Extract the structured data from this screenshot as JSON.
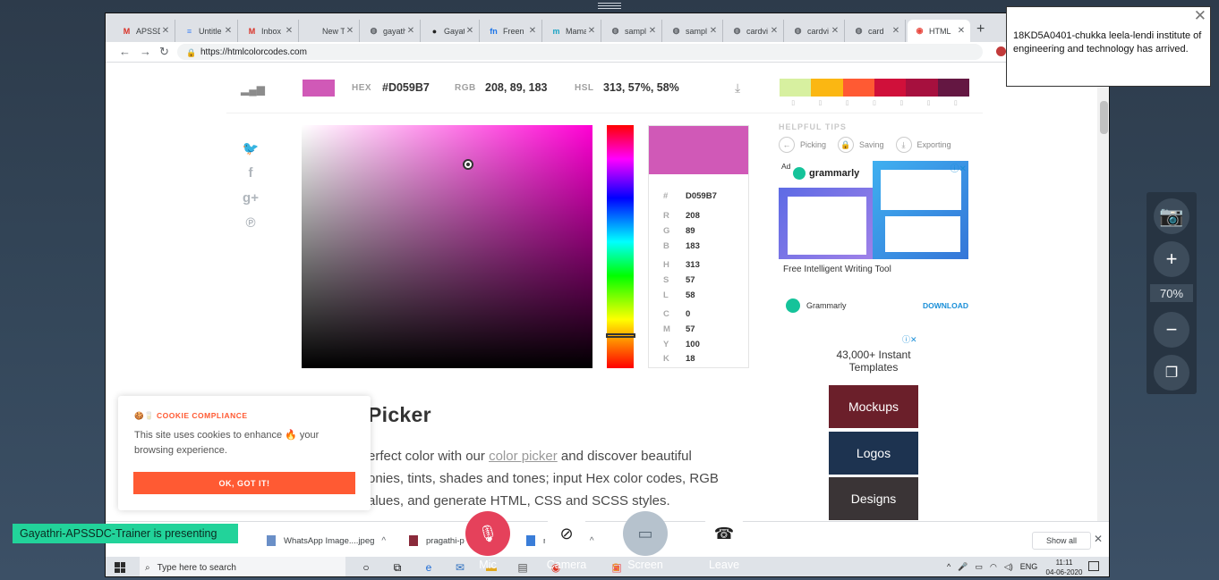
{
  "browser": {
    "tabs": [
      {
        "title": "APSSD",
        "icon": "gmail-icon",
        "color": "#d93025",
        "glyph": "M"
      },
      {
        "title": "Untitle",
        "icon": "docs-icon",
        "color": "#4285f4",
        "glyph": "≡"
      },
      {
        "title": "Inbox",
        "icon": "gmail-icon",
        "color": "#d93025",
        "glyph": "M"
      },
      {
        "title": "New Tab",
        "icon": "none",
        "color": "#5f6368",
        "glyph": ""
      },
      {
        "title": "gayath",
        "icon": "globe-icon",
        "color": "#5f6368",
        "glyph": "◍"
      },
      {
        "title": "Gayath",
        "icon": "github-icon",
        "color": "#222222",
        "glyph": "●"
      },
      {
        "title": "Freen",
        "icon": "freenom-icon",
        "color": "#1a73e8",
        "glyph": "fn"
      },
      {
        "title": "Mama",
        "icon": "mamp-icon",
        "color": "#1aa3c4",
        "glyph": "m"
      },
      {
        "title": "sampl",
        "icon": "globe-icon",
        "color": "#5f6368",
        "glyph": "◍"
      },
      {
        "title": "sampl",
        "icon": "globe-icon",
        "color": "#5f6368",
        "glyph": "◍"
      },
      {
        "title": "cardvi",
        "icon": "globe-icon",
        "color": "#5f6368",
        "glyph": "◍"
      },
      {
        "title": "cardvi",
        "icon": "globe-icon",
        "color": "#5f6368",
        "glyph": "◍"
      },
      {
        "title": "card",
        "icon": "globe-icon",
        "color": "#5f6368",
        "glyph": "◍"
      },
      {
        "title": "HTML",
        "icon": "htmlcolorcodes-icon",
        "color": "#e8453c",
        "glyph": "◉",
        "active": true
      }
    ],
    "new_tab_label": "+",
    "url": "https://htmlcolorcodes.com"
  },
  "color_bar": {
    "hex_label": "HEX",
    "hex_value": "#D059B7",
    "rgb_label": "RGB",
    "rgb_value": "208, 89, 183",
    "hsl_label": "HSL",
    "hsl_value": "313, 57%, 58%",
    "swatch_color": "#d059b7",
    "palette": [
      "#d7f0a0",
      "#fbb712",
      "#ff5a33",
      "#d0103a",
      "#a6103e",
      "#641742"
    ],
    "palette_marks": [
      "▯",
      "▯",
      "▯",
      "▯",
      "▯",
      "▯",
      "▯"
    ]
  },
  "picker": {
    "selected_color": "#d059b7",
    "values": [
      {
        "k": "#",
        "v": "D059B7"
      },
      {
        "k": "R",
        "v": "208"
      },
      {
        "k": "G",
        "v": "89"
      },
      {
        "k": "B",
        "v": "183"
      },
      {
        "k": "H",
        "v": "313"
      },
      {
        "k": "S",
        "v": "57"
      },
      {
        "k": "L",
        "v": "58"
      },
      {
        "k": "C",
        "v": "0"
      },
      {
        "k": "M",
        "v": "57"
      },
      {
        "k": "Y",
        "v": "100"
      },
      {
        "k": "K",
        "v": "18"
      }
    ]
  },
  "tips": {
    "title": "HELPFUL TIPS",
    "items": [
      {
        "label": "Picking",
        "glyph": "←"
      },
      {
        "label": "Saving",
        "glyph": "🔒"
      },
      {
        "label": "Exporting",
        "glyph": "⤓"
      }
    ]
  },
  "ads": {
    "badge": "Ad",
    "grammarly_name": "grammarly",
    "grammarly_tagline": "Free Intelligent Writing Tool",
    "grammarly_footer": "Grammarly",
    "grammarly_cta": "DOWNLOAD",
    "templates_title": "43,000+ Instant Templates",
    "tiles": [
      {
        "label": "Mockups",
        "color": "#6b1f2a"
      },
      {
        "label": "Logos",
        "color": "#1d3350"
      },
      {
        "label": "Designs",
        "color": "#3a3436"
      }
    ]
  },
  "content": {
    "title": "Picker",
    "line1_pre": "erfect color with our ",
    "line1_link": "color picker",
    "line1_post": " and discover beautiful",
    "line2": "onies, tints, shades and tones; input Hex color codes, RGB",
    "line3": "alues, and generate HTML, CSS and SCSS styles."
  },
  "cookie": {
    "title": "COOKIE COMPLIANCE",
    "body": "This site uses cookies to enhance 🔥 your browsing experience.",
    "button": "OK, GOT IT!"
  },
  "downloads": {
    "items": [
      {
        "name": "WhatsApp Image....jpeg"
      },
      {
        "name": "pragathi-p"
      },
      {
        "name": "me_builde"
      }
    ],
    "show_all": "Show all"
  },
  "taskbar": {
    "search_placeholder": "Type here to search",
    "language": "ENG",
    "time": "11:11",
    "date": "04-06-2020"
  },
  "notification": {
    "text": "18KD5A0401-chukka leela-lendi institute of engineering and technology has arrived."
  },
  "zoom": {
    "level": "70%"
  },
  "meeting": {
    "presenting": "Gayathri-APSSDC-Trainer is presenting",
    "mic_label": "Mic",
    "camera_label": "Camera",
    "screen_label": "Screen",
    "leave_label": "Leave"
  }
}
